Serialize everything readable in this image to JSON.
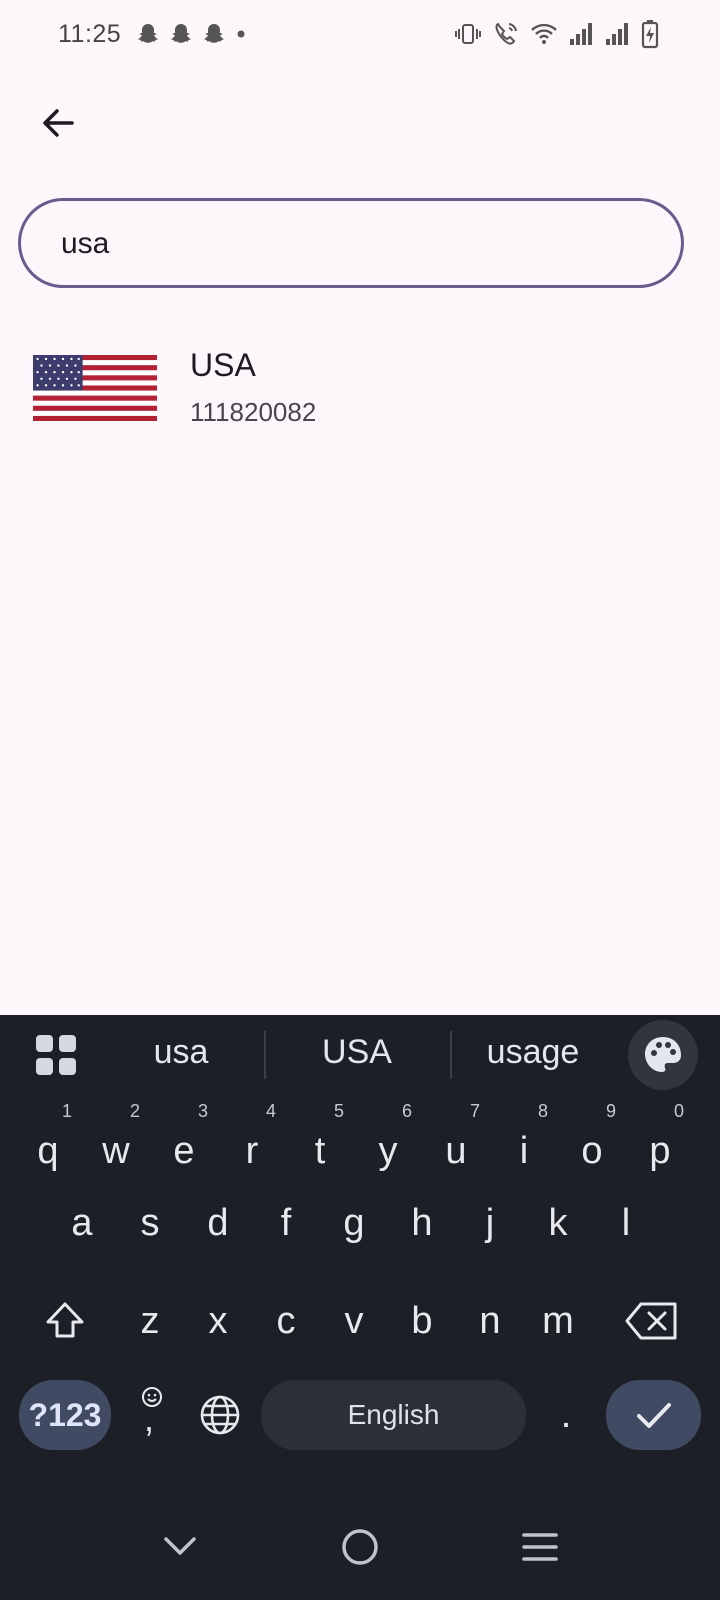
{
  "status_bar": {
    "time": "11:25",
    "left_icons": [
      "snapchat-icon",
      "snapchat-icon",
      "snapchat-icon",
      "dot-icon"
    ],
    "right_icons": [
      "vibrate-icon",
      "wifi-calling-icon",
      "wifi-icon",
      "signal-icon",
      "signal-icon",
      "battery-charging-icon"
    ]
  },
  "header": {
    "back_icon": "arrow-left-icon"
  },
  "search": {
    "value": "usa",
    "placeholder": ""
  },
  "results": [
    {
      "name": "USA",
      "number": "111820082",
      "flag_icon": "us-flag-icon"
    }
  ],
  "keyboard": {
    "suggestions": [
      "usa",
      "USA",
      "usage"
    ],
    "row1": [
      {
        "letter": "q",
        "hint": "1"
      },
      {
        "letter": "w",
        "hint": "2"
      },
      {
        "letter": "e",
        "hint": "3"
      },
      {
        "letter": "r",
        "hint": "4"
      },
      {
        "letter": "t",
        "hint": "5"
      },
      {
        "letter": "y",
        "hint": "6"
      },
      {
        "letter": "u",
        "hint": "7"
      },
      {
        "letter": "i",
        "hint": "8"
      },
      {
        "letter": "o",
        "hint": "9"
      },
      {
        "letter": "p",
        "hint": "0"
      }
    ],
    "row2": [
      "a",
      "s",
      "d",
      "f",
      "g",
      "h",
      "j",
      "k",
      "l"
    ],
    "row3": [
      "z",
      "x",
      "c",
      "v",
      "b",
      "n",
      "m"
    ],
    "symbols_label": "?123",
    "comma_label": ",",
    "space_label": "English",
    "period_label": "."
  },
  "colors": {
    "background": "#fdf7fc",
    "search_border": "#6a5a8e",
    "keyboard_bg": "#1c1f26",
    "accent_key": "#414a63"
  }
}
